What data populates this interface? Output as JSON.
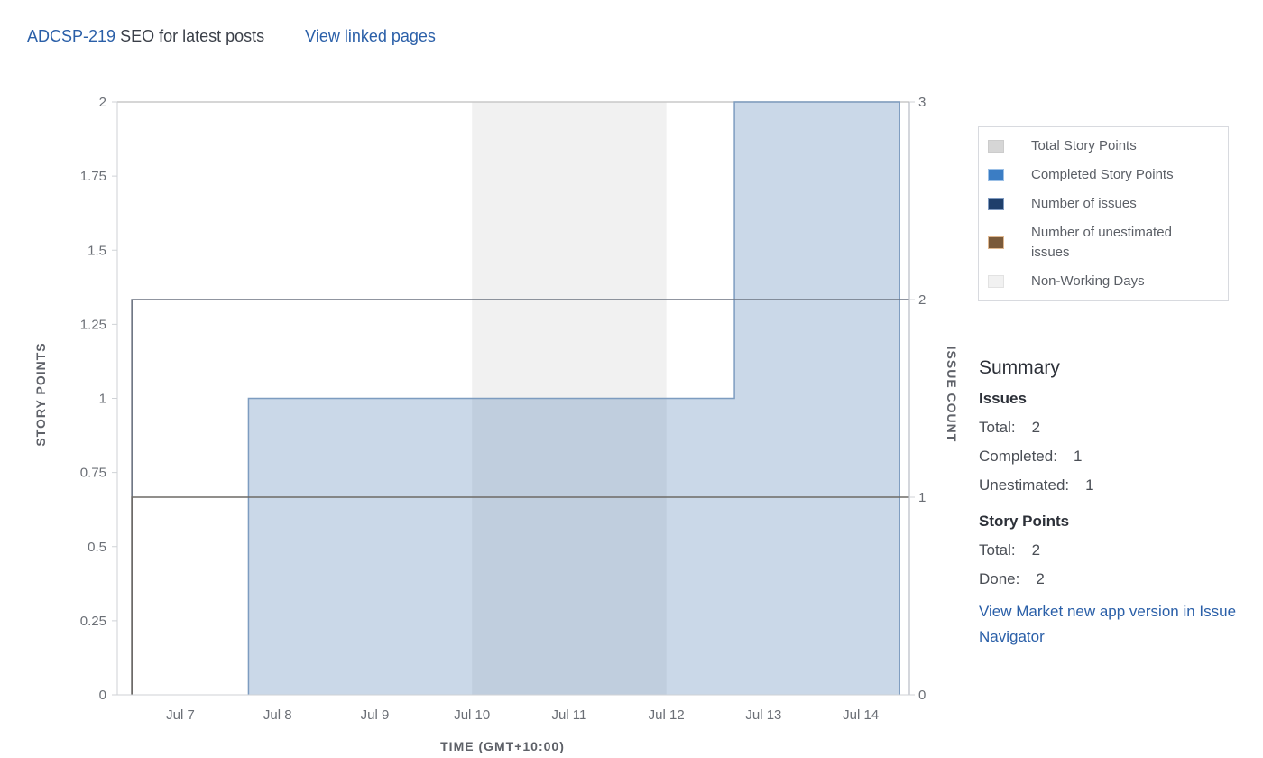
{
  "header": {
    "issue_key": "ADCSP-219",
    "issue_title": "SEO for latest posts",
    "view_linked_pages": "View linked pages"
  },
  "legend": {
    "items": [
      {
        "label": "Total Story Points",
        "color": "#d6d6d6"
      },
      {
        "label": "Completed Story Points",
        "color": "#3b7dc4"
      },
      {
        "label": "Number of issues",
        "color": "#1f3f6b"
      },
      {
        "label": "Number of unestimated issues",
        "color": "#7a5a3a"
      },
      {
        "label": "Non-Working Days",
        "color": "#f1f1f1"
      }
    ]
  },
  "summary": {
    "title": "Summary",
    "issues_heading": "Issues",
    "issues": [
      {
        "label": "Total:",
        "value": "2"
      },
      {
        "label": "Completed:",
        "value": "1"
      },
      {
        "label": "Unestimated:",
        "value": "1"
      }
    ],
    "story_points_heading": "Story Points",
    "story_points": [
      {
        "label": "Total:",
        "value": "2"
      },
      {
        "label": "Done:",
        "value": "2"
      }
    ],
    "navigator_link": "View Market new app version in Issue Navigator"
  },
  "chart_data": {
    "type": "area",
    "xlabel": "TIME (GMT+10:00)",
    "ylabel": "STORY POINTS",
    "y2label": "ISSUE COUNT",
    "x_ticks": [
      "Jul 7",
      "Jul 8",
      "Jul 9",
      "Jul 10",
      "Jul 11",
      "Jul 12",
      "Jul 13",
      "Jul 14"
    ],
    "x_range_days": [
      6.35,
      14.5
    ],
    "ylim": [
      0,
      2
    ],
    "y_ticks": [
      0,
      0.25,
      0.5,
      0.75,
      1,
      1.25,
      1.5,
      1.75,
      2
    ],
    "y_tick_labels": [
      "0",
      "0.25",
      "0.5",
      "0.75",
      "1",
      "1.25",
      "1.5",
      "1.75",
      "2"
    ],
    "y2lim": [
      0,
      3
    ],
    "y2_ticks": [
      0,
      1,
      2,
      3
    ],
    "non_working_days": [
      {
        "start": 10,
        "end": 12
      }
    ],
    "series": [
      {
        "name": "Total Story Points",
        "axis": "left",
        "points": [
          {
            "x": 6.5,
            "y": 2
          },
          {
            "x": 14.5,
            "y": 2
          }
        ]
      },
      {
        "name": "Completed Story Points",
        "axis": "left",
        "step": true,
        "points": [
          {
            "x": 6.5,
            "y": 0
          },
          {
            "x": 7.7,
            "y": 1
          },
          {
            "x": 12.7,
            "y": 2
          },
          {
            "x": 14.4,
            "y": 2
          }
        ]
      },
      {
        "name": "Number of issues",
        "axis": "right",
        "step": true,
        "points": [
          {
            "x": 6.5,
            "y": 0
          },
          {
            "x": 6.5,
            "y": 2
          },
          {
            "x": 14.4,
            "y": 2
          }
        ]
      },
      {
        "name": "Number of unestimated issues",
        "axis": "right",
        "step": true,
        "points": [
          {
            "x": 6.5,
            "y": 0
          },
          {
            "x": 6.5,
            "y": 1
          },
          {
            "x": 14.4,
            "y": 1
          }
        ]
      }
    ],
    "grid": false,
    "legend_position": "right"
  }
}
